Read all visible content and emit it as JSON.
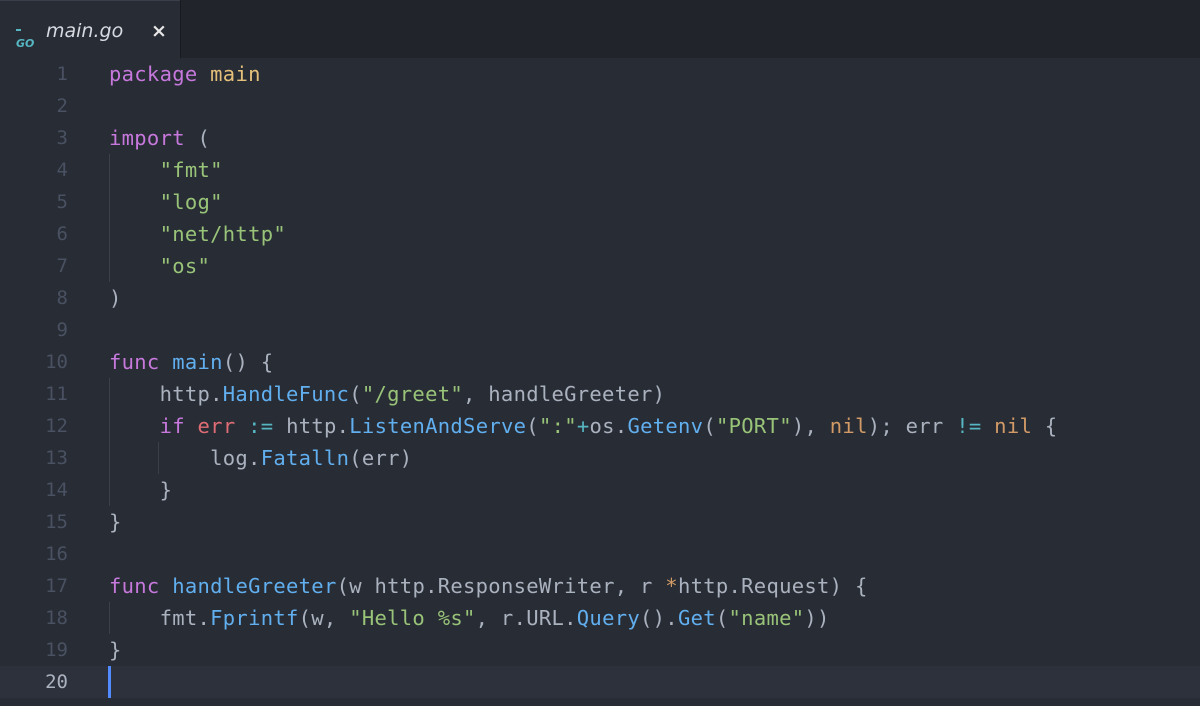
{
  "tab": {
    "file_name": "main.go",
    "icon_label": "GO",
    "close_symbol": "×"
  },
  "editor": {
    "language": "go",
    "current_line": 20,
    "colors": {
      "background": "#282c34",
      "keyword": "#c678dd",
      "string": "#98c379",
      "function": "#61afef",
      "variable": "#e06c75",
      "operator": "#56b6c2",
      "constant": "#d19a66",
      "package_name": "#e5c07b",
      "plain": "#abb2bf",
      "cursor": "#528bff"
    },
    "lines": [
      {
        "n": "1",
        "tokens": [
          [
            "k",
            "package"
          ],
          [
            "t",
            " "
          ],
          [
            "pn",
            "main"
          ]
        ]
      },
      {
        "n": "2",
        "tokens": []
      },
      {
        "n": "3",
        "tokens": [
          [
            "k",
            "import"
          ],
          [
            "t",
            " ("
          ]
        ]
      },
      {
        "n": "4",
        "tokens": [
          [
            "t",
            "    "
          ],
          [
            "s",
            "\"fmt\""
          ]
        ]
      },
      {
        "n": "5",
        "tokens": [
          [
            "t",
            "    "
          ],
          [
            "s",
            "\"log\""
          ]
        ]
      },
      {
        "n": "6",
        "tokens": [
          [
            "t",
            "    "
          ],
          [
            "s",
            "\"net/http\""
          ]
        ]
      },
      {
        "n": "7",
        "tokens": [
          [
            "t",
            "    "
          ],
          [
            "s",
            "\"os\""
          ]
        ]
      },
      {
        "n": "8",
        "tokens": [
          [
            "t",
            ")"
          ]
        ]
      },
      {
        "n": "9",
        "tokens": []
      },
      {
        "n": "10",
        "tokens": [
          [
            "k",
            "func"
          ],
          [
            "t",
            " "
          ],
          [
            "f",
            "main"
          ],
          [
            "t",
            "() {"
          ]
        ]
      },
      {
        "n": "11",
        "tokens": [
          [
            "t",
            "    http."
          ],
          [
            "f",
            "HandleFunc"
          ],
          [
            "t",
            "("
          ],
          [
            "s",
            "\"/greet\""
          ],
          [
            "t",
            ", handleGreeter)"
          ]
        ]
      },
      {
        "n": "12",
        "tokens": [
          [
            "t",
            "    "
          ],
          [
            "k",
            "if"
          ],
          [
            "t",
            " "
          ],
          [
            "v",
            "err"
          ],
          [
            "t",
            " "
          ],
          [
            "o",
            ":="
          ],
          [
            "t",
            " http."
          ],
          [
            "f",
            "ListenAndServe"
          ],
          [
            "t",
            "("
          ],
          [
            "s",
            "\":\""
          ],
          [
            "o",
            "+"
          ],
          [
            "t",
            "os."
          ],
          [
            "f",
            "Getenv"
          ],
          [
            "t",
            "("
          ],
          [
            "s",
            "\"PORT\""
          ],
          [
            "t",
            "), "
          ],
          [
            "n",
            "nil"
          ],
          [
            "t",
            "); err "
          ],
          [
            "o",
            "!="
          ],
          [
            "t",
            " "
          ],
          [
            "n",
            "nil"
          ],
          [
            "t",
            " {"
          ]
        ]
      },
      {
        "n": "13",
        "tokens": [
          [
            "t",
            "        log."
          ],
          [
            "f",
            "Fatalln"
          ],
          [
            "t",
            "(err)"
          ]
        ]
      },
      {
        "n": "14",
        "tokens": [
          [
            "t",
            "    }"
          ]
        ]
      },
      {
        "n": "15",
        "tokens": [
          [
            "t",
            "}"
          ]
        ]
      },
      {
        "n": "16",
        "tokens": []
      },
      {
        "n": "17",
        "tokens": [
          [
            "k",
            "func"
          ],
          [
            "t",
            " "
          ],
          [
            "f",
            "handleGreeter"
          ],
          [
            "t",
            "(w http.ResponseWriter, r "
          ],
          [
            "n",
            "*"
          ],
          [
            "t",
            "http.Request) {"
          ]
        ]
      },
      {
        "n": "18",
        "tokens": [
          [
            "t",
            "    fmt."
          ],
          [
            "f",
            "Fprintf"
          ],
          [
            "t",
            "(w, "
          ],
          [
            "s",
            "\"Hello %s\""
          ],
          [
            "t",
            ", r.URL."
          ],
          [
            "f",
            "Query"
          ],
          [
            "t",
            "()."
          ],
          [
            "f",
            "Get"
          ],
          [
            "t",
            "("
          ],
          [
            "s",
            "\"name\""
          ],
          [
            "t",
            "))"
          ]
        ]
      },
      {
        "n": "19",
        "tokens": [
          [
            "t",
            "}"
          ]
        ]
      },
      {
        "n": "20",
        "tokens": []
      }
    ]
  }
}
